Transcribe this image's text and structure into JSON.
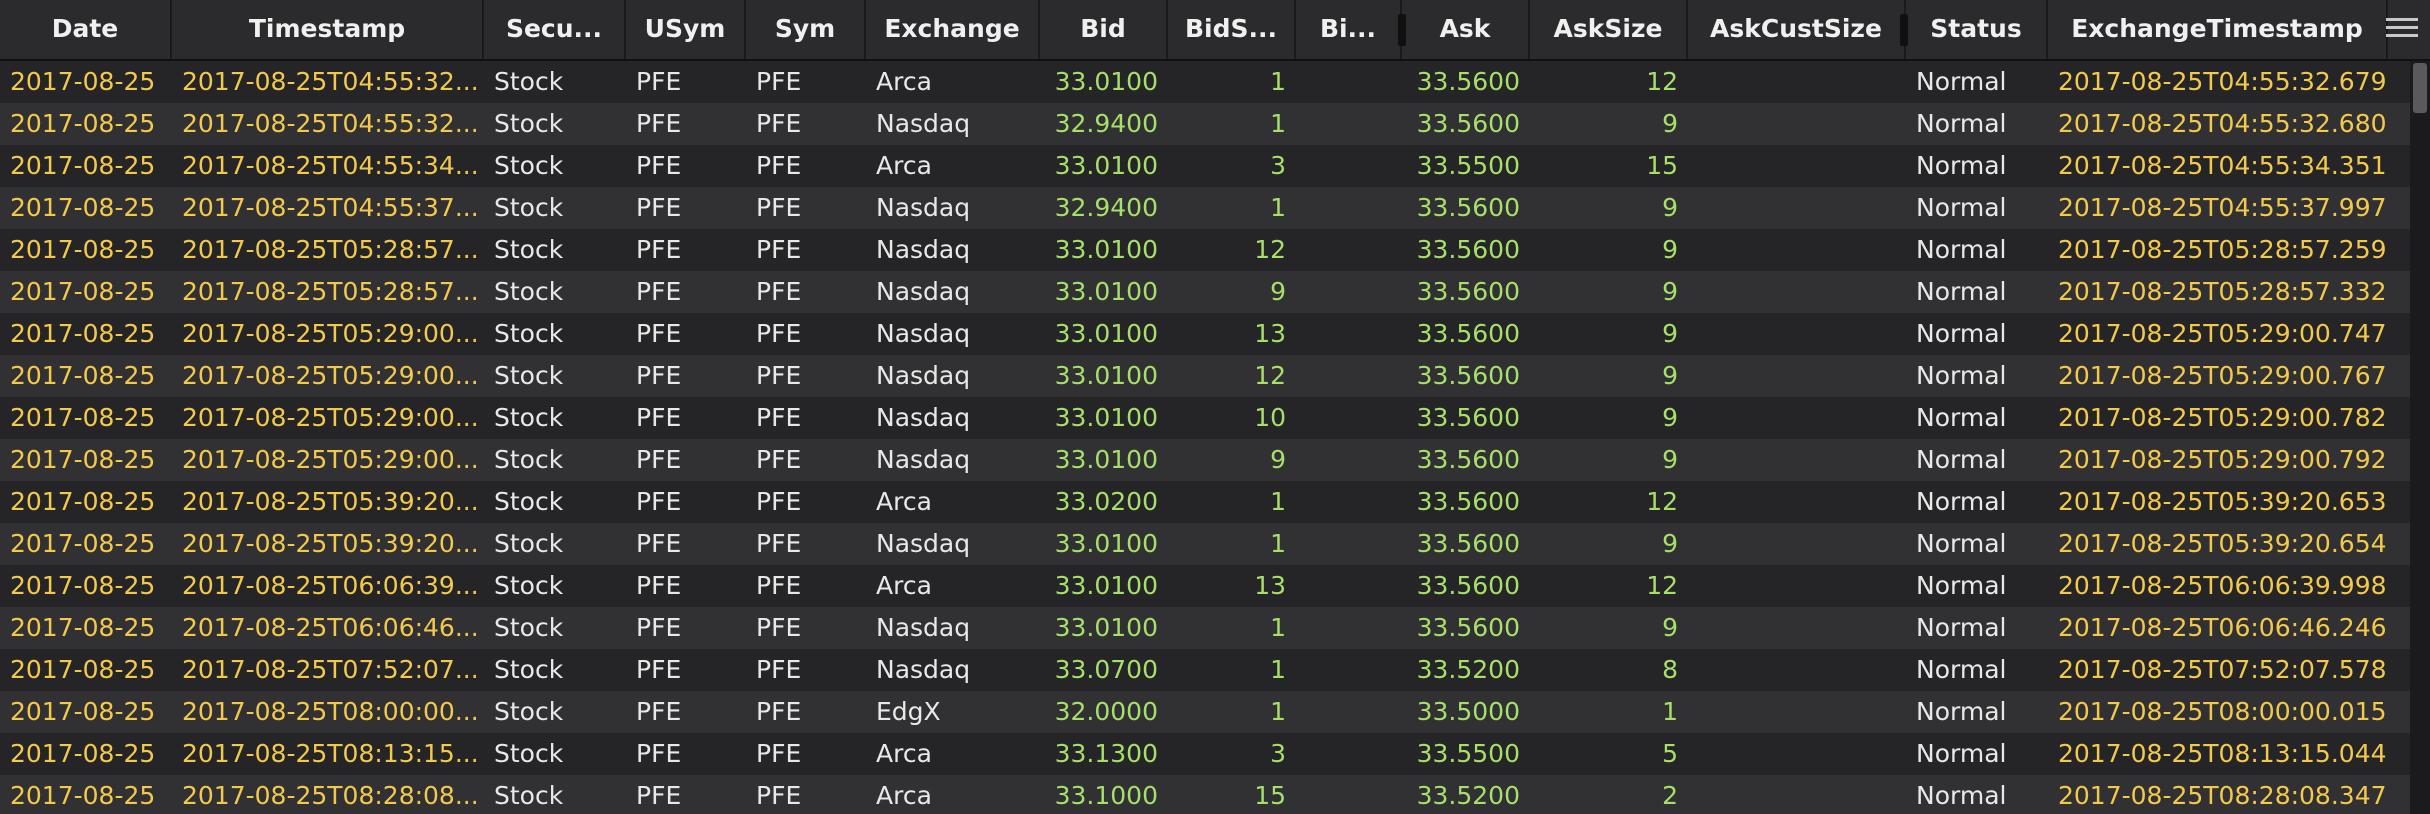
{
  "columns": [
    {
      "key": "date",
      "label": "Date"
    },
    {
      "key": "timestamp",
      "label": "Timestamp"
    },
    {
      "key": "security",
      "label": "Secu..."
    },
    {
      "key": "usym",
      "label": "USym"
    },
    {
      "key": "sym",
      "label": "Sym"
    },
    {
      "key": "exchange",
      "label": "Exchange"
    },
    {
      "key": "bid",
      "label": "Bid"
    },
    {
      "key": "bidsize",
      "label": "BidS..."
    },
    {
      "key": "bidcust",
      "label": "Bi..."
    },
    {
      "key": "ask",
      "label": "Ask"
    },
    {
      "key": "asksize",
      "label": "AskSize"
    },
    {
      "key": "askcustsize",
      "label": "AskCustSize"
    },
    {
      "key": "status",
      "label": "Status"
    },
    {
      "key": "exchangetimestamp",
      "label": "ExchangeTimestamp"
    }
  ],
  "rows": [
    {
      "date": "2017-08-25",
      "timestamp": "2017-08-25T04:55:32...",
      "security": "Stock",
      "usym": "PFE",
      "sym": "PFE",
      "exchange": "Arca",
      "bid": "33.0100",
      "bidsize": "1",
      "bidcust": "",
      "ask": "33.5600",
      "asksize": "12",
      "askcustsize": "",
      "status": "Normal",
      "exchangetimestamp": "2017-08-25T04:55:32.679"
    },
    {
      "date": "2017-08-25",
      "timestamp": "2017-08-25T04:55:32...",
      "security": "Stock",
      "usym": "PFE",
      "sym": "PFE",
      "exchange": "Nasdaq",
      "bid": "32.9400",
      "bidsize": "1",
      "bidcust": "",
      "ask": "33.5600",
      "asksize": "9",
      "askcustsize": "",
      "status": "Normal",
      "exchangetimestamp": "2017-08-25T04:55:32.680"
    },
    {
      "date": "2017-08-25",
      "timestamp": "2017-08-25T04:55:34...",
      "security": "Stock",
      "usym": "PFE",
      "sym": "PFE",
      "exchange": "Arca",
      "bid": "33.0100",
      "bidsize": "3",
      "bidcust": "",
      "ask": "33.5500",
      "asksize": "15",
      "askcustsize": "",
      "status": "Normal",
      "exchangetimestamp": "2017-08-25T04:55:34.351"
    },
    {
      "date": "2017-08-25",
      "timestamp": "2017-08-25T04:55:37...",
      "security": "Stock",
      "usym": "PFE",
      "sym": "PFE",
      "exchange": "Nasdaq",
      "bid": "32.9400",
      "bidsize": "1",
      "bidcust": "",
      "ask": "33.5600",
      "asksize": "9",
      "askcustsize": "",
      "status": "Normal",
      "exchangetimestamp": "2017-08-25T04:55:37.997"
    },
    {
      "date": "2017-08-25",
      "timestamp": "2017-08-25T05:28:57...",
      "security": "Stock",
      "usym": "PFE",
      "sym": "PFE",
      "exchange": "Nasdaq",
      "bid": "33.0100",
      "bidsize": "12",
      "bidcust": "",
      "ask": "33.5600",
      "asksize": "9",
      "askcustsize": "",
      "status": "Normal",
      "exchangetimestamp": "2017-08-25T05:28:57.259"
    },
    {
      "date": "2017-08-25",
      "timestamp": "2017-08-25T05:28:57...",
      "security": "Stock",
      "usym": "PFE",
      "sym": "PFE",
      "exchange": "Nasdaq",
      "bid": "33.0100",
      "bidsize": "9",
      "bidcust": "",
      "ask": "33.5600",
      "asksize": "9",
      "askcustsize": "",
      "status": "Normal",
      "exchangetimestamp": "2017-08-25T05:28:57.332"
    },
    {
      "date": "2017-08-25",
      "timestamp": "2017-08-25T05:29:00...",
      "security": "Stock",
      "usym": "PFE",
      "sym": "PFE",
      "exchange": "Nasdaq",
      "bid": "33.0100",
      "bidsize": "13",
      "bidcust": "",
      "ask": "33.5600",
      "asksize": "9",
      "askcustsize": "",
      "status": "Normal",
      "exchangetimestamp": "2017-08-25T05:29:00.747"
    },
    {
      "date": "2017-08-25",
      "timestamp": "2017-08-25T05:29:00...",
      "security": "Stock",
      "usym": "PFE",
      "sym": "PFE",
      "exchange": "Nasdaq",
      "bid": "33.0100",
      "bidsize": "12",
      "bidcust": "",
      "ask": "33.5600",
      "asksize": "9",
      "askcustsize": "",
      "status": "Normal",
      "exchangetimestamp": "2017-08-25T05:29:00.767"
    },
    {
      "date": "2017-08-25",
      "timestamp": "2017-08-25T05:29:00...",
      "security": "Stock",
      "usym": "PFE",
      "sym": "PFE",
      "exchange": "Nasdaq",
      "bid": "33.0100",
      "bidsize": "10",
      "bidcust": "",
      "ask": "33.5600",
      "asksize": "9",
      "askcustsize": "",
      "status": "Normal",
      "exchangetimestamp": "2017-08-25T05:29:00.782"
    },
    {
      "date": "2017-08-25",
      "timestamp": "2017-08-25T05:29:00...",
      "security": "Stock",
      "usym": "PFE",
      "sym": "PFE",
      "exchange": "Nasdaq",
      "bid": "33.0100",
      "bidsize": "9",
      "bidcust": "",
      "ask": "33.5600",
      "asksize": "9",
      "askcustsize": "",
      "status": "Normal",
      "exchangetimestamp": "2017-08-25T05:29:00.792"
    },
    {
      "date": "2017-08-25",
      "timestamp": "2017-08-25T05:39:20...",
      "security": "Stock",
      "usym": "PFE",
      "sym": "PFE",
      "exchange": "Arca",
      "bid": "33.0200",
      "bidsize": "1",
      "bidcust": "",
      "ask": "33.5600",
      "asksize": "12",
      "askcustsize": "",
      "status": "Normal",
      "exchangetimestamp": "2017-08-25T05:39:20.653"
    },
    {
      "date": "2017-08-25",
      "timestamp": "2017-08-25T05:39:20...",
      "security": "Stock",
      "usym": "PFE",
      "sym": "PFE",
      "exchange": "Nasdaq",
      "bid": "33.0100",
      "bidsize": "1",
      "bidcust": "",
      "ask": "33.5600",
      "asksize": "9",
      "askcustsize": "",
      "status": "Normal",
      "exchangetimestamp": "2017-08-25T05:39:20.654"
    },
    {
      "date": "2017-08-25",
      "timestamp": "2017-08-25T06:06:39...",
      "security": "Stock",
      "usym": "PFE",
      "sym": "PFE",
      "exchange": "Arca",
      "bid": "33.0100",
      "bidsize": "13",
      "bidcust": "",
      "ask": "33.5600",
      "asksize": "12",
      "askcustsize": "",
      "status": "Normal",
      "exchangetimestamp": "2017-08-25T06:06:39.998"
    },
    {
      "date": "2017-08-25",
      "timestamp": "2017-08-25T06:06:46...",
      "security": "Stock",
      "usym": "PFE",
      "sym": "PFE",
      "exchange": "Nasdaq",
      "bid": "33.0100",
      "bidsize": "1",
      "bidcust": "",
      "ask": "33.5600",
      "asksize": "9",
      "askcustsize": "",
      "status": "Normal",
      "exchangetimestamp": "2017-08-25T06:06:46.246"
    },
    {
      "date": "2017-08-25",
      "timestamp": "2017-08-25T07:52:07...",
      "security": "Stock",
      "usym": "PFE",
      "sym": "PFE",
      "exchange": "Nasdaq",
      "bid": "33.0700",
      "bidsize": "1",
      "bidcust": "",
      "ask": "33.5200",
      "asksize": "8",
      "askcustsize": "",
      "status": "Normal",
      "exchangetimestamp": "2017-08-25T07:52:07.578"
    },
    {
      "date": "2017-08-25",
      "timestamp": "2017-08-25T08:00:00...",
      "security": "Stock",
      "usym": "PFE",
      "sym": "PFE",
      "exchange": "EdgX",
      "bid": "32.0000",
      "bidsize": "1",
      "bidcust": "",
      "ask": "33.5000",
      "asksize": "1",
      "askcustsize": "",
      "status": "Normal",
      "exchangetimestamp": "2017-08-25T08:00:00.015"
    },
    {
      "date": "2017-08-25",
      "timestamp": "2017-08-25T08:13:15...",
      "security": "Stock",
      "usym": "PFE",
      "sym": "PFE",
      "exchange": "Arca",
      "bid": "33.1300",
      "bidsize": "3",
      "bidcust": "",
      "ask": "33.5500",
      "asksize": "5",
      "askcustsize": "",
      "status": "Normal",
      "exchangetimestamp": "2017-08-25T08:13:15.044"
    },
    {
      "date": "2017-08-25",
      "timestamp": "2017-08-25T08:28:08...",
      "security": "Stock",
      "usym": "PFE",
      "sym": "PFE",
      "exchange": "Arca",
      "bid": "33.1000",
      "bidsize": "15",
      "bidcust": "",
      "ask": "33.5200",
      "asksize": "2",
      "askcustsize": "",
      "status": "Normal",
      "exchangetimestamp": "2017-08-25T08:28:08.347"
    }
  ],
  "colors": {
    "timestamp_text": "#f2c94c",
    "text": "#e8e8e8",
    "numeric_text": "#a6df6a",
    "header_bg": "#2b2b2d",
    "row_odd": "#252527",
    "row_even": "#313133"
  },
  "icons": {
    "column_menu": "hamburger-menu-icon"
  }
}
